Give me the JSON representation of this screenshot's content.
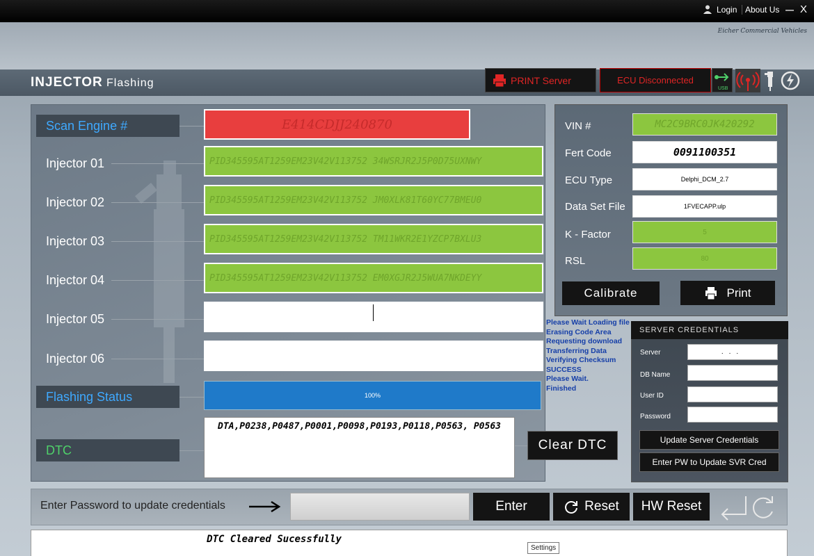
{
  "topbar": {
    "login": "Login",
    "about": "About Us",
    "minimize": "—",
    "close": "X"
  },
  "brand": "Eicher Commercial Vehicles",
  "app": {
    "title_bold": "INJECTOR",
    "title_rest": "Flashing"
  },
  "header": {
    "print_server": "PRINT Server",
    "ecu_status": "ECU Disconnected",
    "usb": "USB"
  },
  "form": {
    "scan_engine_label": "Scan Engine #",
    "scan_engine_value": "E414CDJJ240870",
    "injectors": [
      {
        "label": "Injector 01",
        "value": "PID345595AT1259EM23V42V113752 34WSRJR2J5P0D75UXNWY"
      },
      {
        "label": "Injector 02",
        "value": "PID345595AT1259EM23V42V113752 JM0XLK81T60YC77BMEU0"
      },
      {
        "label": "Injector 03",
        "value": "PID345595AT1259EM23V42V113752 TM11WKR2E1YZCP7BXLU3"
      },
      {
        "label": "Injector 04",
        "value": "PID345595AT1259EM23V42V113752 EM0XGJR2J5WUA7NKDEYY"
      },
      {
        "label": "Injector 05",
        "value": ""
      },
      {
        "label": "Injector 06",
        "value": ""
      }
    ],
    "flashing_status_label": "Flashing Status",
    "progress": "100%",
    "progress_fraction": 1.0,
    "dtc_label": "DTC",
    "dtc_value": "DTA,P0238,P0487,P0001,P0098,P0193,P0118,P0563, P0563",
    "clear_dtc": "Clear DTC"
  },
  "log": [
    "Please Wait Loading file",
    "Erasing Code Area",
    "Requesting download",
    "Transferring Data",
    "Verifying Checksum",
    "SUCCESS",
    "Please Wait.",
    "Finished"
  ],
  "vehicle": {
    "vin_label": "VIN #",
    "vin_value": "MC2C9BRC0JK420292",
    "fert_label": "Fert Code",
    "fert_value": "0091100351",
    "ecu_label": "ECU Type",
    "ecu_value": "Delphi_DCM_2.7",
    "dataset_label": "Data Set File",
    "dataset_value": "1FVECAPP.ulp",
    "kfactor_label": "K - Factor",
    "kfactor_value": "5",
    "rsl_label": "RSL",
    "rsl_value": "80",
    "calibrate": "Calibrate",
    "print": "Print"
  },
  "server": {
    "title": "SERVER CREDENTIALS",
    "server_label": "Server",
    "server_value": "...",
    "db_label": "DB Name",
    "db_value": "",
    "user_label": "User ID",
    "user_value": "",
    "password_label": "Password",
    "password_value": "",
    "update_btn": "Update Server Credentials",
    "enter_pw_btn": "Enter PW to Update SVR Cred"
  },
  "password_bar": {
    "label": "Enter Password to update credentials",
    "enter": "Enter",
    "reset": "Reset",
    "hw_reset": "HW Reset"
  },
  "status": {
    "message": "DTC Cleared Sucessfully",
    "tooltip": "Settings"
  },
  "colors": {
    "green_field": "#8cc63f",
    "red_field": "#e83e3e",
    "progress": "#1f7ac9",
    "accent_blue": "#3fa9ff"
  }
}
